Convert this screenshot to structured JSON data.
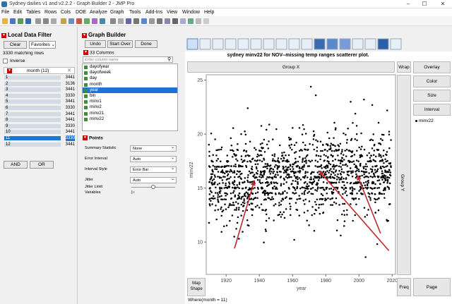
{
  "window": {
    "title": "Sydney dailies v1 and v2.2.2 - Graph Builder 2 - JMP Pro",
    "min": "–",
    "max": "☐",
    "close": "✕"
  },
  "menu": [
    "File",
    "Edit",
    "Tables",
    "Rows",
    "Cols",
    "DOE",
    "Analyze",
    "Graph",
    "Tools",
    "Add-Ins",
    "View",
    "Window",
    "Help"
  ],
  "filter": {
    "title": "Local Data Filter",
    "clear": "Clear",
    "favorites": "Favorites",
    "matching": "3330 matching rows",
    "inverse": "Inverse",
    "column_header": "month (12)",
    "rows": [
      {
        "label": "1",
        "count": "3441"
      },
      {
        "label": "2",
        "count": "3136"
      },
      {
        "label": "3",
        "count": "3441"
      },
      {
        "label": "4",
        "count": "3330"
      },
      {
        "label": "5",
        "count": "3441"
      },
      {
        "label": "6",
        "count": "3330"
      },
      {
        "label": "7",
        "count": "3441"
      },
      {
        "label": "8",
        "count": "3441"
      },
      {
        "label": "9",
        "count": "3330"
      },
      {
        "label": "10",
        "count": "3441"
      },
      {
        "label": "11",
        "count": "3330"
      },
      {
        "label": "12",
        "count": "3441"
      }
    ],
    "and": "AND",
    "or": "OR"
  },
  "builder": {
    "title": "Graph Builder",
    "undo": "Undo",
    "start_over": "Start Over",
    "done": "Done",
    "columns_header": "33 Columns",
    "search_placeholder": "Enter column name",
    "columns": [
      "dayofyear",
      "dayofweek",
      "day",
      "month",
      "year",
      "bin",
      "minv1",
      "minv2",
      "minv21",
      "minv22"
    ],
    "selected_column": "year",
    "points_header": "Points",
    "props": [
      {
        "label": "Summary Statistic",
        "value": "None"
      },
      {
        "label": "Error Interval",
        "value": "Auto"
      },
      {
        "label": "Interval Style",
        "value": "Error Bar"
      },
      {
        "label": "Jitter",
        "value": "Auto"
      },
      {
        "label": "Jitter Limit",
        "value": ""
      },
      {
        "label": "Variables",
        "value": ""
      }
    ]
  },
  "graph": {
    "title": "sydney minv22 for NOV--missing temp ranges scatterer plot.",
    "group_x": "Group X",
    "group_y": "Group Y",
    "wrap": "Wrap",
    "overlay": "Overlay",
    "color": "Color",
    "size": "Size",
    "interval": "Interval",
    "legend_item": "minv22",
    "map_shape": "Map Shape",
    "freq": "Freq",
    "page": "Page",
    "where": "Where(month = 11)"
  },
  "chart_data": {
    "type": "scatter",
    "xlabel": "year",
    "ylabel": "minv22",
    "xlim": [
      1908,
      2022
    ],
    "ylim": [
      7,
      25.5
    ],
    "xticks": [
      1920,
      1940,
      1960,
      1980,
      2000,
      2020
    ],
    "yticks": [
      10,
      15,
      20,
      25
    ],
    "color": "#000000",
    "annotation_color": "#c0282d",
    "series": [
      {
        "name": "minv22",
        "note": "daily November minimum temperatures 1910–2019, densest between 13 and 19"
      }
    ]
  }
}
